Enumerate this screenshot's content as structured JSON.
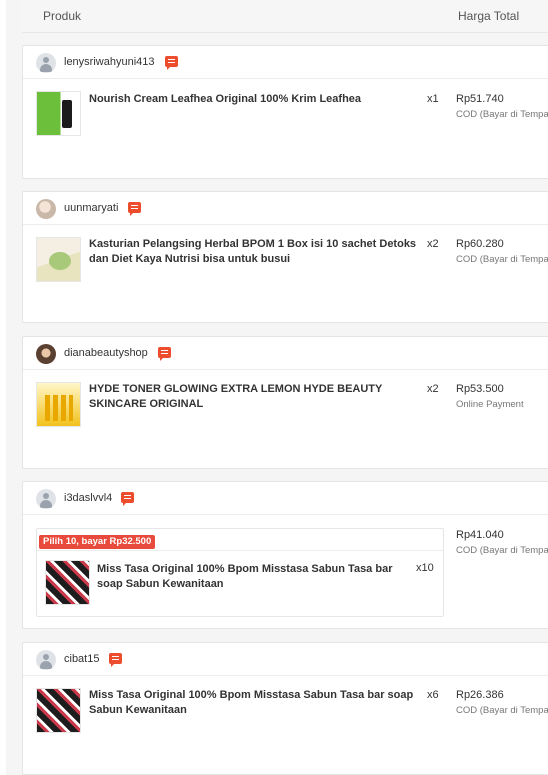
{
  "header": {
    "product_col": "Produk",
    "price_col": "Harga Total"
  },
  "orders": [
    {
      "username": "lenysriwahyuni413",
      "product": "Nourish Cream Leafhea Original 100% Krim Leafhea",
      "qty": "x1",
      "price": "Rp51.740",
      "payment": "COD (Bayar di Tempat)"
    },
    {
      "username": "uunmaryati",
      "product": "Kasturian Pelangsing Herbal BPOM 1 Box isi 10 sachet Detoks dan Diet Kaya Nutrisi bisa untuk busui",
      "qty": "x2",
      "price": "Rp60.280",
      "payment": "COD (Bayar di Tempat)"
    },
    {
      "username": "dianabeautyshop",
      "product": "HYDE TONER GLOWING EXTRA LEMON HYDE BEAUTY SKINCARE ORIGINAL",
      "qty": "x2",
      "price": "Rp53.500",
      "payment": "Online Payment"
    },
    {
      "username": "i3daslvvl4",
      "bundle_label": "Pilih 10, bayar Rp32.500",
      "product": "Miss Tasa Original 100% Bpom Misstasa Sabun Tasa bar soap Sabun Kewanitaan",
      "qty": "x10",
      "price": "Rp41.040",
      "payment": "COD (Bayar di Tempat)"
    },
    {
      "username": "cibat15",
      "product": "Miss Tasa Original 100% Bpom Misstasa Sabun Tasa bar soap Sabun Kewanitaan",
      "qty": "x6",
      "price": "Rp26.386",
      "payment": "COD (Bayar di Tempat)"
    }
  ]
}
